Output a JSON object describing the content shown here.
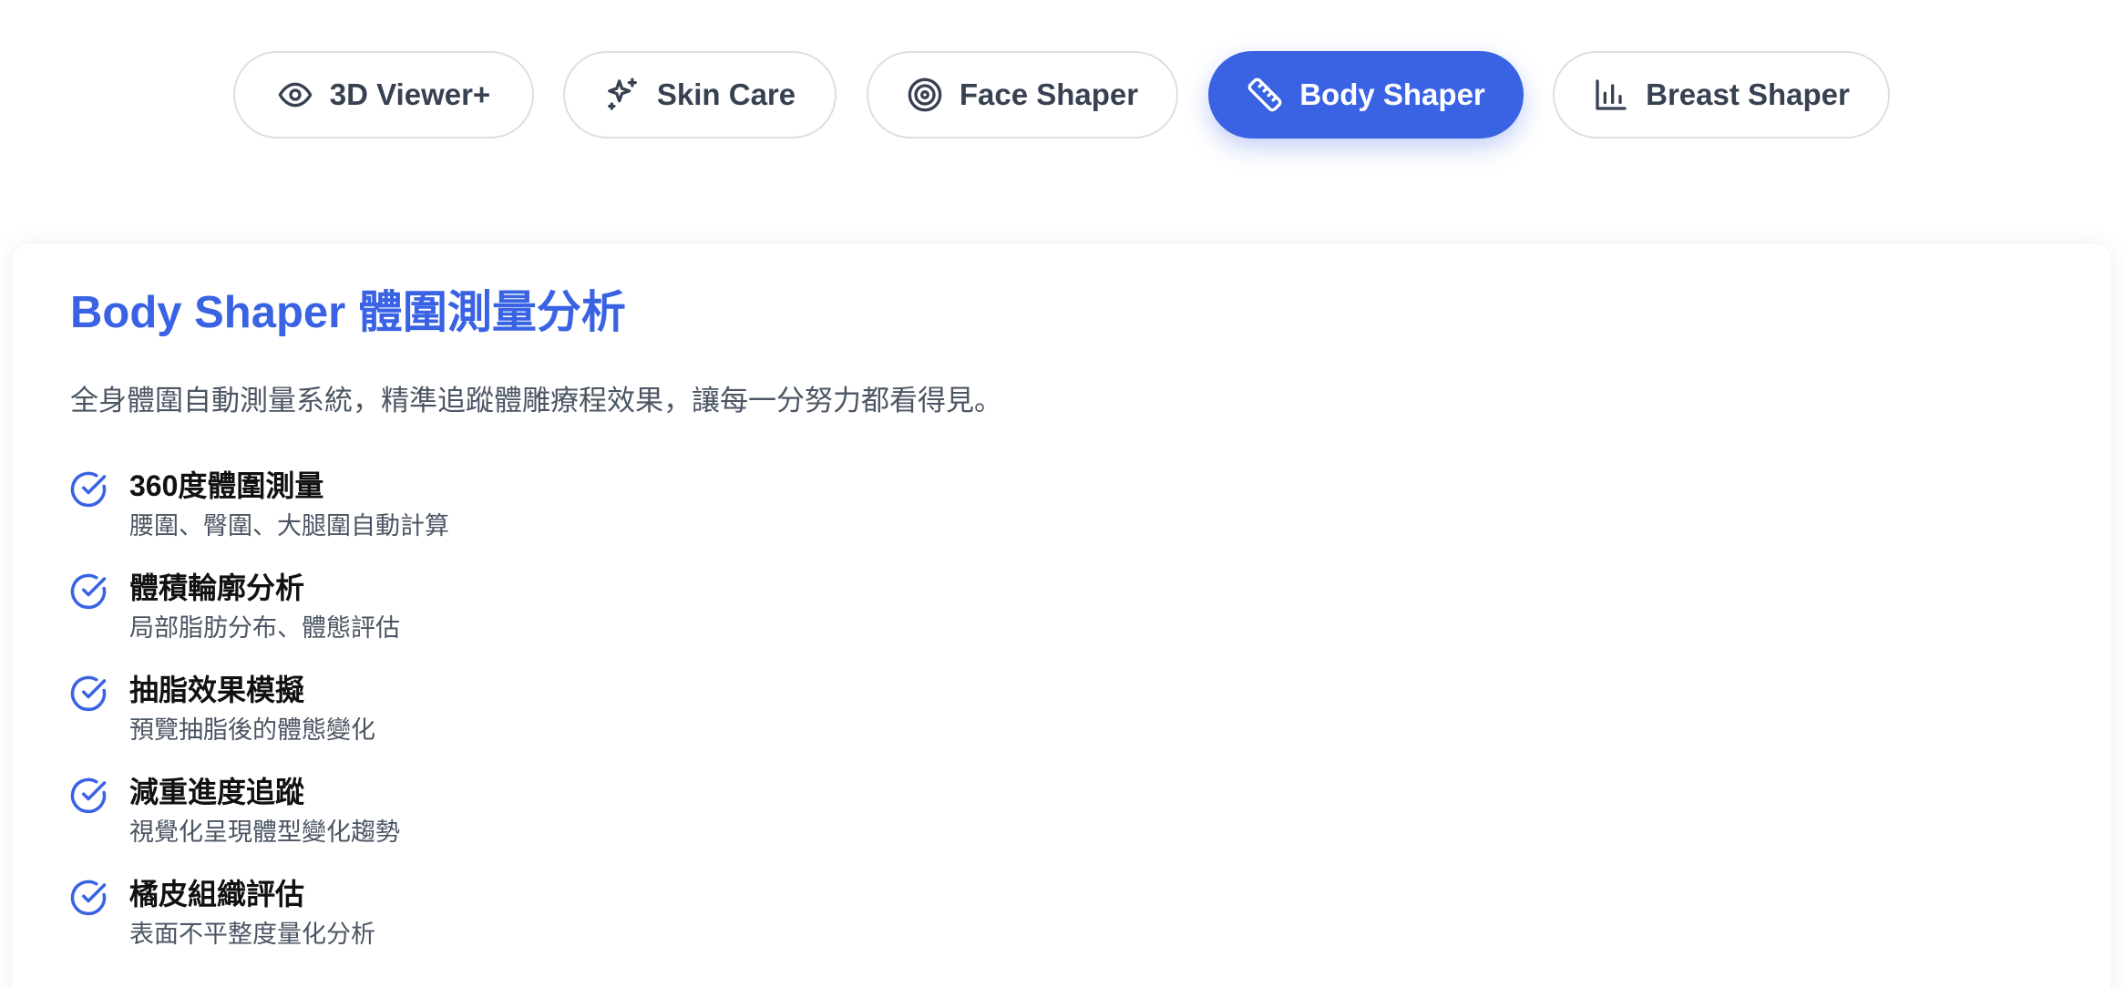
{
  "tabs": [
    {
      "label": "3D Viewer+",
      "icon": "eye-icon",
      "active": false
    },
    {
      "label": "Skin Care",
      "icon": "sparkles-icon",
      "active": false
    },
    {
      "label": "Face Shaper",
      "icon": "target-icon",
      "active": false
    },
    {
      "label": "Body Shaper",
      "icon": "ruler-icon",
      "active": true
    },
    {
      "label": "Breast Shaper",
      "icon": "bar-chart-icon",
      "active": false
    }
  ],
  "panel": {
    "title": "Body Shaper 體圍測量分析",
    "description": "全身體圍自動測量系統，精準追蹤體雕療程效果，讓每一分努力都看得見。",
    "features": [
      {
        "title": "360度體圍測量",
        "subtitle": "腰圍、臀圍、大腿圍自動計算"
      },
      {
        "title": "體積輪廓分析",
        "subtitle": "局部脂肪分布、體態評估"
      },
      {
        "title": "抽脂效果模擬",
        "subtitle": "預覽抽脂後的體態變化"
      },
      {
        "title": "減重進度追蹤",
        "subtitle": "視覺化呈現體型變化趨勢"
      },
      {
        "title": "橘皮組織評估",
        "subtitle": "表面不平整度量化分析"
      }
    ]
  },
  "colors": {
    "accent": "#3a63e3",
    "tab_border": "#dcdfe5",
    "text_dark": "#111111",
    "text_muted": "#4b5563"
  }
}
